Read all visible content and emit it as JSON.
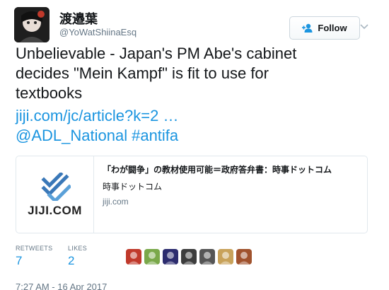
{
  "author": {
    "display_name": "渡邉葉",
    "handle": "@YoWatShiinaEsq"
  },
  "follow_button": {
    "label": "Follow"
  },
  "tweet": {
    "text_lines": [
      "Unbelievable - Japan's PM Abe's cabinet",
      "decides \"Mein Kampf\" is fit to use for",
      "textbooks"
    ],
    "link": "jiji.com/jc/article?k=2 …",
    "mention": "@ADL_National",
    "hashtag": "#antifa"
  },
  "card": {
    "logo_text": "JIJI.COM",
    "title": "「わが闘争」の教材使用可能＝政府答弁書：時事ドットコム",
    "description": "時事ドットコム",
    "domain": "jiji.com"
  },
  "stats": {
    "retweets_label": "RETWEETS",
    "retweets_value": "7",
    "likes_label": "LIKES",
    "likes_value": "2"
  },
  "likers": [
    {
      "name": "liker-1",
      "color": "#c0392b"
    },
    {
      "name": "liker-2",
      "color": "#7aa84a"
    },
    {
      "name": "liker-3",
      "color": "#2c2c6e"
    },
    {
      "name": "liker-4",
      "color": "#3d3d3d"
    },
    {
      "name": "liker-5",
      "color": "#555555"
    },
    {
      "name": "liker-6",
      "color": "#c8a25a"
    },
    {
      "name": "liker-7",
      "color": "#a0522d"
    }
  ],
  "timestamp": "7:27 AM - 16 Apr 2017",
  "colors": {
    "link": "#1b95e0",
    "secondary_text": "#657786",
    "border": "#e1e8ed"
  },
  "icons": {
    "follow": "add-user-icon",
    "menu": "chevron-down-icon",
    "logo": "jiji-logo-icon"
  }
}
